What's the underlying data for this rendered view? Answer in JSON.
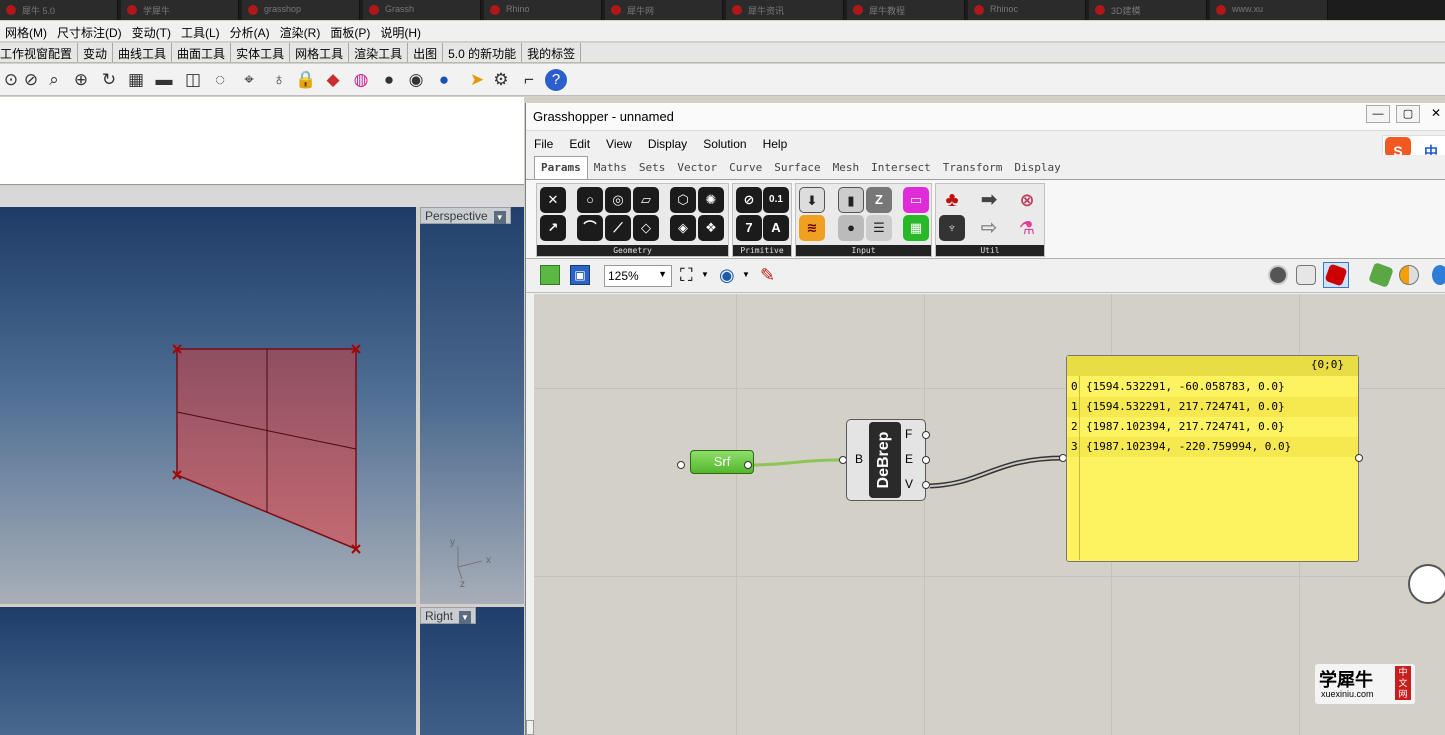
{
  "taskbar": {
    "items": [
      "犀牛 5.0",
      "学犀牛",
      "grasshop",
      "Grassh",
      "Rhino",
      "犀牛网",
      "犀牛资讯",
      "犀牛教程",
      "Rhinoc",
      "3D建模",
      "www.xu"
    ]
  },
  "rhino_menu": {
    "items": [
      "网格(M)",
      "尺寸标注(D)",
      "变动(T)",
      "工具(L)",
      "分析(A)",
      "渲染(R)",
      "面板(P)",
      "说明(H)"
    ]
  },
  "rhino_tabs": {
    "items": [
      "工作视窗配置",
      "变动",
      "曲线工具",
      "曲面工具",
      "实体工具",
      "网格工具",
      "渲染工具",
      "出图",
      "5.0 的新功能",
      "我的标签"
    ]
  },
  "rhino_toolbar": {
    "icons": [
      "zoom-window-icon",
      "zoom-extents-icon",
      "zoom-selected-icon",
      "zoom-target-icon",
      "rotate-view-icon",
      "four-viewports-icon",
      "car-icon",
      "render-icon",
      "lens-icon",
      "object-snap-icon",
      "light-bulb-icon",
      "lock-icon",
      "material-icon",
      "color-wheel-icon",
      "sphere-icon",
      "sphere-grid-icon",
      "blue-sphere-icon",
      "pointer-icon",
      "gear-icon",
      "crop-icon",
      "help-icon"
    ],
    "glyphs": [
      "⊙",
      "⊘",
      "⌕",
      "⊕",
      "↻",
      "▦",
      "▬",
      "◫",
      "◌",
      "⌖",
      "♁",
      "🔒",
      "◆",
      "◍",
      "●",
      "◉",
      "●",
      "➤",
      "⚙",
      "⌐",
      "?"
    ]
  },
  "viewports": {
    "perspective": "Perspective",
    "right": "Right",
    "axis_y": "y",
    "axis_x": "x",
    "axis_z": "z"
  },
  "grasshopper": {
    "title": "Grasshopper - unnamed",
    "menu": [
      "File",
      "Edit",
      "View",
      "Display",
      "Solution",
      "Help"
    ],
    "tabs": [
      "Params",
      "Maths",
      "Sets",
      "Vector",
      "Curve",
      "Surface",
      "Mesh",
      "Intersect",
      "Transform",
      "Display"
    ],
    "ribbon_groups": [
      "Geometry",
      "Primitive",
      "Input",
      "Util"
    ],
    "zoom": "125%",
    "ime_label": "中",
    "components": {
      "srf": "Srf",
      "debrep": "DeBrep",
      "debrep_input": "B",
      "debrep_outputs": [
        "F",
        "E",
        "V"
      ]
    },
    "panel": {
      "header": "{0;0}",
      "rows": [
        {
          "index": "0",
          "value": "{1594.532291, -60.058783, 0.0}"
        },
        {
          "index": "1",
          "value": "{1594.532291, 217.724741, 0.0}"
        },
        {
          "index": "2",
          "value": "{1987.102394, 217.724741, 0.0}"
        },
        {
          "index": "3",
          "value": "{1987.102394, -220.759994, 0.0}"
        }
      ]
    }
  },
  "watermark": {
    "title": "学犀牛",
    "url": "xuexiniu.com",
    "badge": "中文网"
  },
  "colors": {
    "surface_fill": "#b85a66",
    "surface_edge": "#7a0c14",
    "srf_green": "#5cbf33",
    "panel_yellow": "#fdf25f"
  }
}
